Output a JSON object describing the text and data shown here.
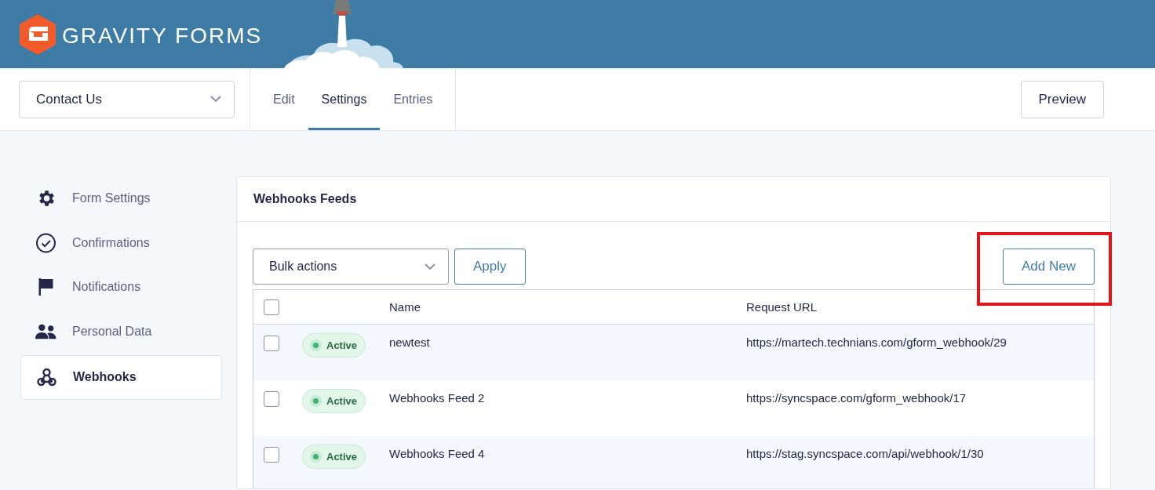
{
  "header": {
    "logo_text": "GRAVITY FORMS"
  },
  "form_selector": {
    "value": "Contact Us"
  },
  "tabs": [
    {
      "label": "Edit",
      "selected": false
    },
    {
      "label": "Settings",
      "selected": true
    },
    {
      "label": "Entries",
      "selected": false
    }
  ],
  "preview_button": "Preview",
  "sidebar": {
    "items": [
      {
        "label": "Form Settings",
        "selected": false
      },
      {
        "label": "Confirmations",
        "selected": false
      },
      {
        "label": "Notifications",
        "selected": false
      },
      {
        "label": "Personal Data",
        "selected": false
      },
      {
        "label": "Webhooks",
        "selected": true
      }
    ]
  },
  "panel": {
    "title": "Webhooks Feeds",
    "bulk_actions": {
      "value": "Bulk actions"
    },
    "apply_button": "Apply",
    "add_new_button": "Add New",
    "table": {
      "select_all_checked": false,
      "columns": [
        "Name",
        "Request URL"
      ],
      "rows": [
        {
          "checked": false,
          "status": "Active",
          "name": "newtest",
          "url": "https://martech.technians.com/gform_webhook/29"
        },
        {
          "checked": false,
          "status": "Active",
          "name": "Webhooks Feed 2",
          "url": "https://syncspace.com/gform_webhook/17"
        },
        {
          "checked": false,
          "status": "Active",
          "name": "Webhooks Feed 4",
          "url": "https://stag.syncspace.com/api/webhook/1/30"
        }
      ]
    }
  }
}
